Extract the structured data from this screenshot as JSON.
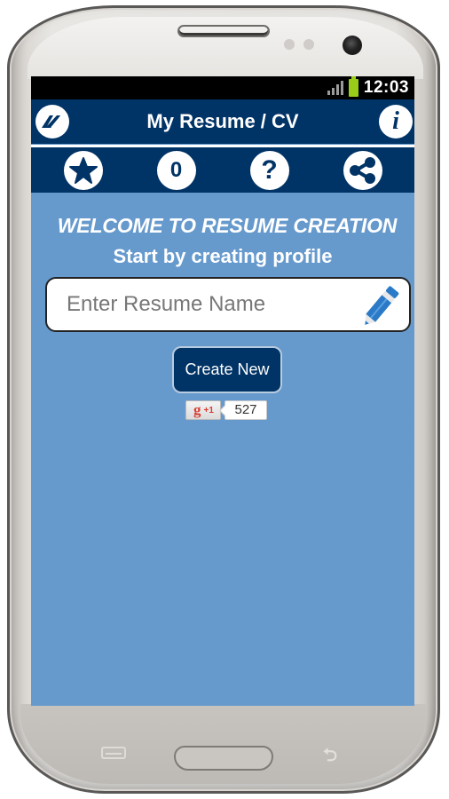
{
  "status_bar": {
    "time": "12:03",
    "signal_icon": "signal-icon",
    "battery_icon": "battery-icon"
  },
  "app_bar": {
    "title": "My Resume / CV",
    "logo_icon": "app-logo-icon",
    "info_label": "i"
  },
  "toolbar": {
    "items": [
      {
        "name": "favorite",
        "icon": "star-icon",
        "label": ""
      },
      {
        "name": "count",
        "icon": "count-badge",
        "label": "0"
      },
      {
        "name": "help",
        "icon": "help-icon",
        "label": "?"
      },
      {
        "name": "share",
        "icon": "share-icon",
        "label": ""
      }
    ]
  },
  "main": {
    "welcome": "WELCOME TO RESUME CREATION",
    "subtitle": "Start by creating profile",
    "resume_name_input": {
      "value": "",
      "placeholder": "Enter Resume Name",
      "icon": "pencil-icon"
    },
    "create_button": "Create New",
    "google_plus": {
      "g_label": "g",
      "plus_label": "+1",
      "count": "527"
    }
  },
  "colors": {
    "primary": "#003366",
    "background": "#6699cc",
    "pencil": "#2a7ac7",
    "gplus_red": "#d73d32"
  }
}
